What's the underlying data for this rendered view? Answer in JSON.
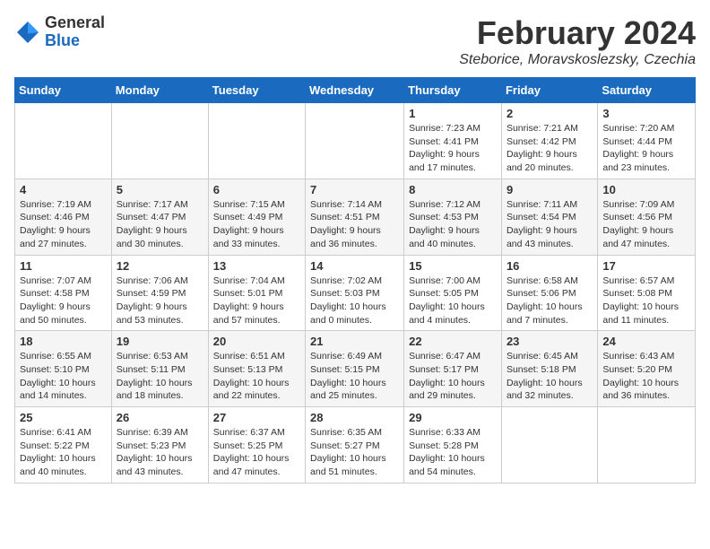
{
  "logo": {
    "general": "General",
    "blue": "Blue"
  },
  "title": "February 2024",
  "subtitle": "Steborice, Moravskoslezsky, Czechia",
  "weekdays": [
    "Sunday",
    "Monday",
    "Tuesday",
    "Wednesday",
    "Thursday",
    "Friday",
    "Saturday"
  ],
  "weeks": [
    [
      {
        "day": "",
        "info": ""
      },
      {
        "day": "",
        "info": ""
      },
      {
        "day": "",
        "info": ""
      },
      {
        "day": "",
        "info": ""
      },
      {
        "day": "1",
        "info": "Sunrise: 7:23 AM\nSunset: 4:41 PM\nDaylight: 9 hours\nand 17 minutes."
      },
      {
        "day": "2",
        "info": "Sunrise: 7:21 AM\nSunset: 4:42 PM\nDaylight: 9 hours\nand 20 minutes."
      },
      {
        "day": "3",
        "info": "Sunrise: 7:20 AM\nSunset: 4:44 PM\nDaylight: 9 hours\nand 23 minutes."
      }
    ],
    [
      {
        "day": "4",
        "info": "Sunrise: 7:19 AM\nSunset: 4:46 PM\nDaylight: 9 hours\nand 27 minutes."
      },
      {
        "day": "5",
        "info": "Sunrise: 7:17 AM\nSunset: 4:47 PM\nDaylight: 9 hours\nand 30 minutes."
      },
      {
        "day": "6",
        "info": "Sunrise: 7:15 AM\nSunset: 4:49 PM\nDaylight: 9 hours\nand 33 minutes."
      },
      {
        "day": "7",
        "info": "Sunrise: 7:14 AM\nSunset: 4:51 PM\nDaylight: 9 hours\nand 36 minutes."
      },
      {
        "day": "8",
        "info": "Sunrise: 7:12 AM\nSunset: 4:53 PM\nDaylight: 9 hours\nand 40 minutes."
      },
      {
        "day": "9",
        "info": "Sunrise: 7:11 AM\nSunset: 4:54 PM\nDaylight: 9 hours\nand 43 minutes."
      },
      {
        "day": "10",
        "info": "Sunrise: 7:09 AM\nSunset: 4:56 PM\nDaylight: 9 hours\nand 47 minutes."
      }
    ],
    [
      {
        "day": "11",
        "info": "Sunrise: 7:07 AM\nSunset: 4:58 PM\nDaylight: 9 hours\nand 50 minutes."
      },
      {
        "day": "12",
        "info": "Sunrise: 7:06 AM\nSunset: 4:59 PM\nDaylight: 9 hours\nand 53 minutes."
      },
      {
        "day": "13",
        "info": "Sunrise: 7:04 AM\nSunset: 5:01 PM\nDaylight: 9 hours\nand 57 minutes."
      },
      {
        "day": "14",
        "info": "Sunrise: 7:02 AM\nSunset: 5:03 PM\nDaylight: 10 hours\nand 0 minutes."
      },
      {
        "day": "15",
        "info": "Sunrise: 7:00 AM\nSunset: 5:05 PM\nDaylight: 10 hours\nand 4 minutes."
      },
      {
        "day": "16",
        "info": "Sunrise: 6:58 AM\nSunset: 5:06 PM\nDaylight: 10 hours\nand 7 minutes."
      },
      {
        "day": "17",
        "info": "Sunrise: 6:57 AM\nSunset: 5:08 PM\nDaylight: 10 hours\nand 11 minutes."
      }
    ],
    [
      {
        "day": "18",
        "info": "Sunrise: 6:55 AM\nSunset: 5:10 PM\nDaylight: 10 hours\nand 14 minutes."
      },
      {
        "day": "19",
        "info": "Sunrise: 6:53 AM\nSunset: 5:11 PM\nDaylight: 10 hours\nand 18 minutes."
      },
      {
        "day": "20",
        "info": "Sunrise: 6:51 AM\nSunset: 5:13 PM\nDaylight: 10 hours\nand 22 minutes."
      },
      {
        "day": "21",
        "info": "Sunrise: 6:49 AM\nSunset: 5:15 PM\nDaylight: 10 hours\nand 25 minutes."
      },
      {
        "day": "22",
        "info": "Sunrise: 6:47 AM\nSunset: 5:17 PM\nDaylight: 10 hours\nand 29 minutes."
      },
      {
        "day": "23",
        "info": "Sunrise: 6:45 AM\nSunset: 5:18 PM\nDaylight: 10 hours\nand 32 minutes."
      },
      {
        "day": "24",
        "info": "Sunrise: 6:43 AM\nSunset: 5:20 PM\nDaylight: 10 hours\nand 36 minutes."
      }
    ],
    [
      {
        "day": "25",
        "info": "Sunrise: 6:41 AM\nSunset: 5:22 PM\nDaylight: 10 hours\nand 40 minutes."
      },
      {
        "day": "26",
        "info": "Sunrise: 6:39 AM\nSunset: 5:23 PM\nDaylight: 10 hours\nand 43 minutes."
      },
      {
        "day": "27",
        "info": "Sunrise: 6:37 AM\nSunset: 5:25 PM\nDaylight: 10 hours\nand 47 minutes."
      },
      {
        "day": "28",
        "info": "Sunrise: 6:35 AM\nSunset: 5:27 PM\nDaylight: 10 hours\nand 51 minutes."
      },
      {
        "day": "29",
        "info": "Sunrise: 6:33 AM\nSunset: 5:28 PM\nDaylight: 10 hours\nand 54 minutes."
      },
      {
        "day": "",
        "info": ""
      },
      {
        "day": "",
        "info": ""
      }
    ]
  ]
}
